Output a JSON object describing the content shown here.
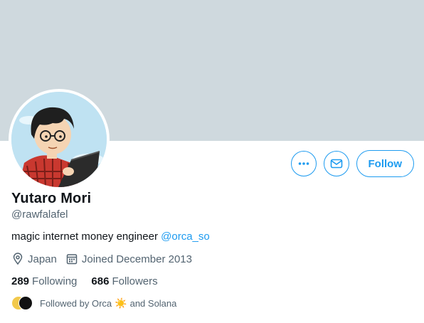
{
  "profile": {
    "name": "Yutaro Mori",
    "handle": "@rawfalafel",
    "bio_text": "magic internet money engineer ",
    "bio_mention": "@orca_so",
    "location": "Japan",
    "joined": "Joined December 2013",
    "following_count": "289",
    "following_label": "Following",
    "followers_count": "686",
    "followers_label": "Followers"
  },
  "actions": {
    "more_icon": "ellipsis-icon",
    "message_icon": "envelope-icon",
    "follow_label": "Follow"
  },
  "followed_by": {
    "prefix": "Followed by Orca",
    "emoji": "☀️",
    "suffix": "and Solana"
  },
  "colors": {
    "banner": "#cfd9de",
    "accent": "#1d9bf0",
    "muted_text": "#536471"
  }
}
